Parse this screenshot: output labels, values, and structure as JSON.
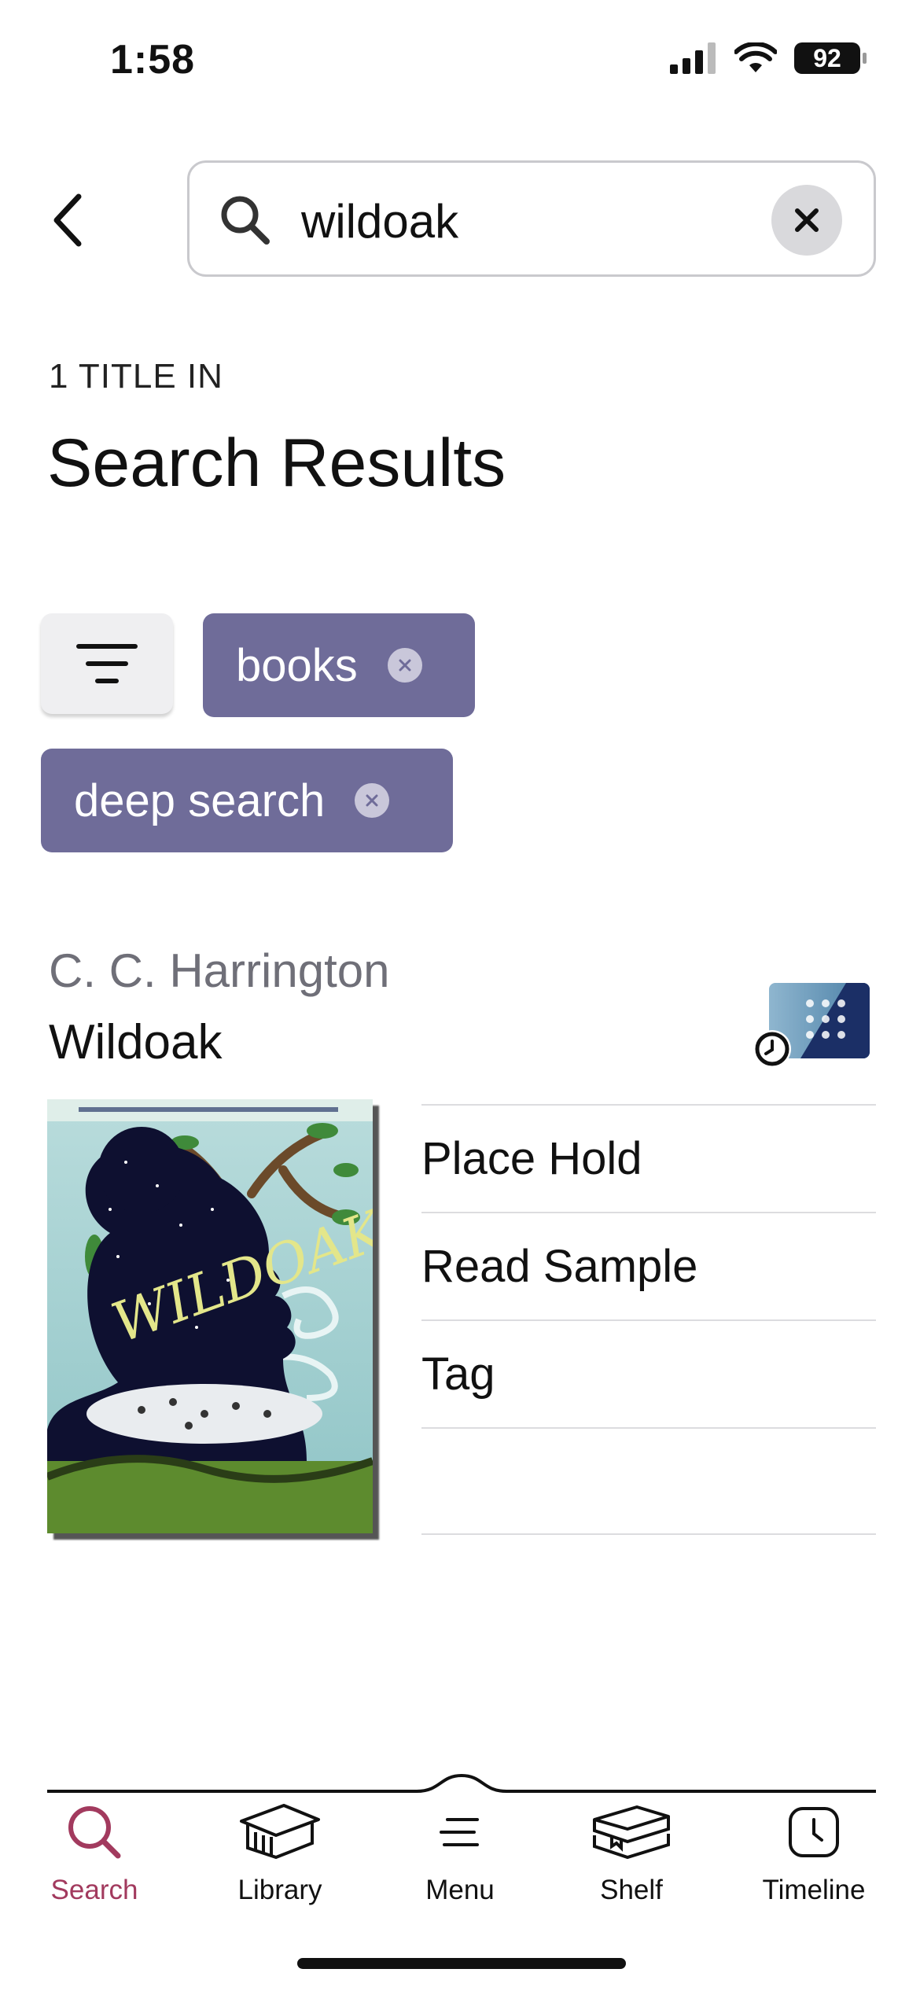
{
  "status_bar": {
    "time": "1:58",
    "battery": "92"
  },
  "search": {
    "query": "wildoak"
  },
  "results": {
    "count_label": "1 TITLE IN",
    "title": "Search Results"
  },
  "filters": {
    "chips": [
      {
        "label": "books"
      },
      {
        "label": "deep search"
      }
    ]
  },
  "result_item": {
    "author": "C. C. Harrington",
    "title": "Wildoak",
    "actions": [
      "Place Hold",
      "Read Sample",
      "Tag",
      ""
    ]
  },
  "nav": {
    "items": [
      {
        "label": "Search",
        "icon": "search-icon",
        "active": true
      },
      {
        "label": "Library",
        "icon": "library-icon",
        "active": false
      },
      {
        "label": "Menu",
        "icon": "menu-icon",
        "active": false
      },
      {
        "label": "Shelf",
        "icon": "shelf-icon",
        "active": false
      },
      {
        "label": "Timeline",
        "icon": "clock-icon",
        "active": false
      }
    ]
  },
  "colors": {
    "chip": "#6f6c99",
    "active_nav": "#a23a5e",
    "author": "#6f6f78"
  }
}
